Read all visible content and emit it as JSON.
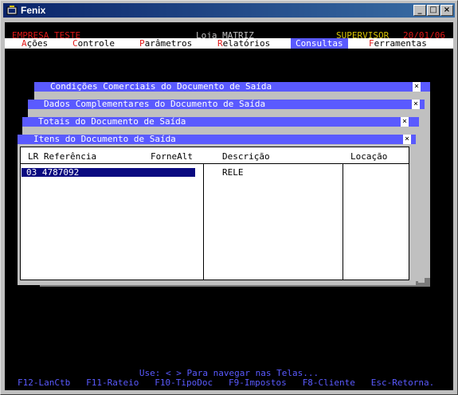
{
  "window": {
    "title": "Fenix",
    "minimize": "_",
    "maximize": "□",
    "close": "×"
  },
  "header": {
    "company": "EMPRESA TESTE",
    "store": "Loja MATRIZ",
    "user": "SUPERVISOR",
    "date": "20/01/06"
  },
  "menu": [
    {
      "hotkey": "A",
      "rest": "ções"
    },
    {
      "hotkey": "C",
      "rest": "ontrole"
    },
    {
      "hotkey": "P",
      "rest": "arâmetros"
    },
    {
      "hotkey": "R",
      "rest": "elatórios"
    },
    {
      "hotkey": "",
      "rest": "Consultas"
    },
    {
      "hotkey": "F",
      "rest": "erramentas"
    }
  ],
  "popups": [
    {
      "title": "Condições Comerciais do Documento de Saída",
      "close": "×"
    },
    {
      "title": "Dados Complementares do Documento de Saída",
      "close": "×"
    },
    {
      "title": "Totais do Documento de Saída",
      "close": "×"
    },
    {
      "title": "Itens do Documento de Saída",
      "close": "×"
    }
  ],
  "table": {
    "headers": {
      "lr_ref": "LR Referência",
      "forne": "ForneAlt",
      "descricao": "Descrição",
      "locacao": "Locação"
    },
    "rows": [
      {
        "lr_ref": "03 4787092",
        "descricao": "RELE",
        "locacao": ""
      }
    ]
  },
  "footer": {
    "help": "Use: < > Para navegar nas Telas...",
    "fkeys": [
      "F12-LanCtb",
      "F11-Rateio",
      "F10-TipoDoc",
      "F9-Impostos",
      "F8-Cliente",
      "Esc-Retorna."
    ]
  },
  "colors": {
    "accent_blue": "#5a5aff",
    "hotkey_red": "#e01818",
    "user_yellow": "#d8c400",
    "selection": "#0a0a80"
  }
}
